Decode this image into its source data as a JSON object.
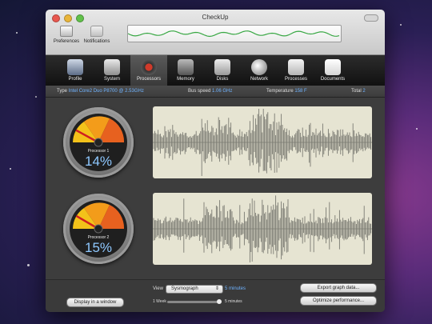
{
  "window": {
    "title": "CheckUp"
  },
  "toolbar": {
    "preferences_label": "Preferences",
    "notifications_label": "Notifications"
  },
  "tabs": [
    {
      "label": "Profile",
      "icon": "monitor-icon",
      "active": false
    },
    {
      "label": "System",
      "icon": "tools-icon",
      "active": false
    },
    {
      "label": "Processors",
      "icon": "gauge-icon",
      "active": true
    },
    {
      "label": "Memory",
      "icon": "memory-chip-icon",
      "active": false
    },
    {
      "label": "Disks",
      "icon": "disk-icon",
      "active": false
    },
    {
      "label": "Network",
      "icon": "globe-icon",
      "active": false
    },
    {
      "label": "Processes",
      "icon": "switch-icon",
      "active": false
    },
    {
      "label": "Documents",
      "icon": "document-icon",
      "active": false
    }
  ],
  "info": {
    "type_label": "Type",
    "type_value": "Intel Core2 Duo P8700 @ 2.53GHz",
    "bus_label": "Bus speed",
    "bus_value": "1.06 GHz",
    "temp_label": "Temperature",
    "temp_value": "158 F",
    "total_label": "Total",
    "total_value": "2"
  },
  "processors": [
    {
      "label": "Processor 1",
      "value": "14%",
      "load": 0.14
    },
    {
      "label": "Processor 2",
      "value": "15%",
      "load": 0.15
    }
  ],
  "controls": {
    "display_in_window": "Display in a window",
    "view_label": "View",
    "view_select": "Sysmograph",
    "duration_top": "5 minutes",
    "slider_left": "1 Week",
    "slider_right": "5 minutes",
    "export_button": "Export graph data...",
    "optimize_button": "Optimize performance..."
  },
  "colors": {
    "accent_blue": "#6fb3ff",
    "wave_bg": "#e6e4d2",
    "strip_green": "#3aa845"
  }
}
